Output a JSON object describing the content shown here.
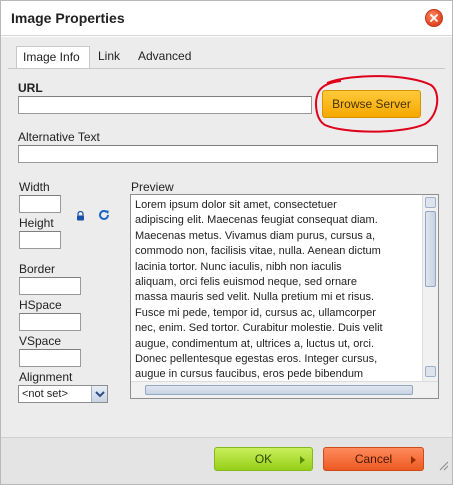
{
  "dialog": {
    "title": "Image Properties"
  },
  "tabs": [
    {
      "label": "Image Info",
      "active": true
    },
    {
      "label": "Link",
      "active": false
    },
    {
      "label": "Advanced",
      "active": false
    }
  ],
  "form": {
    "url_label": "URL",
    "url_value": "",
    "browse_label": "Browse Server",
    "alt_label": "Alternative Text",
    "alt_value": "",
    "width_label": "Width",
    "width_value": "",
    "height_label": "Height",
    "height_value": "",
    "border_label": "Border",
    "border_value": "",
    "hspace_label": "HSpace",
    "hspace_value": "",
    "vspace_label": "VSpace",
    "vspace_value": "",
    "alignment_label": "Alignment",
    "alignment_value": "<not set>"
  },
  "preview": {
    "label": "Preview",
    "lines": [
      "Lorem ipsum dolor sit amet, consectetuer",
      "adipiscing elit. Maecenas feugiat consequat diam.",
      "Maecenas metus. Vivamus diam purus, cursus a,",
      "commodo non, facilisis vitae, nulla. Aenean dictum",
      "lacinia tortor. Nunc iaculis, nibh non iaculis",
      "aliquam, orci felis euismod neque, sed ornare",
      "massa mauris sed velit. Nulla pretium mi et risus.",
      "Fusce mi pede, tempor id, cursus ac, ullamcorper",
      "nec, enim. Sed tortor. Curabitur molestie. Duis velit",
      "augue, condimentum at, ultrices a, luctus ut, orci.",
      "Donec pellentesque egestas eros. Integer cursus,",
      "augue in cursus faucibus, eros pede bibendum"
    ]
  },
  "footer": {
    "ok_label": "OK",
    "cancel_label": "Cancel"
  },
  "colors": {
    "browse": "#f5a800",
    "ok": "#96cf18",
    "cancel": "#ec5a22",
    "highlight_circle": "#e0001b"
  },
  "icons": [
    "close-icon",
    "lock-icon",
    "reset-size-icon",
    "chevron-down-icon",
    "resize-grip-icon"
  ]
}
